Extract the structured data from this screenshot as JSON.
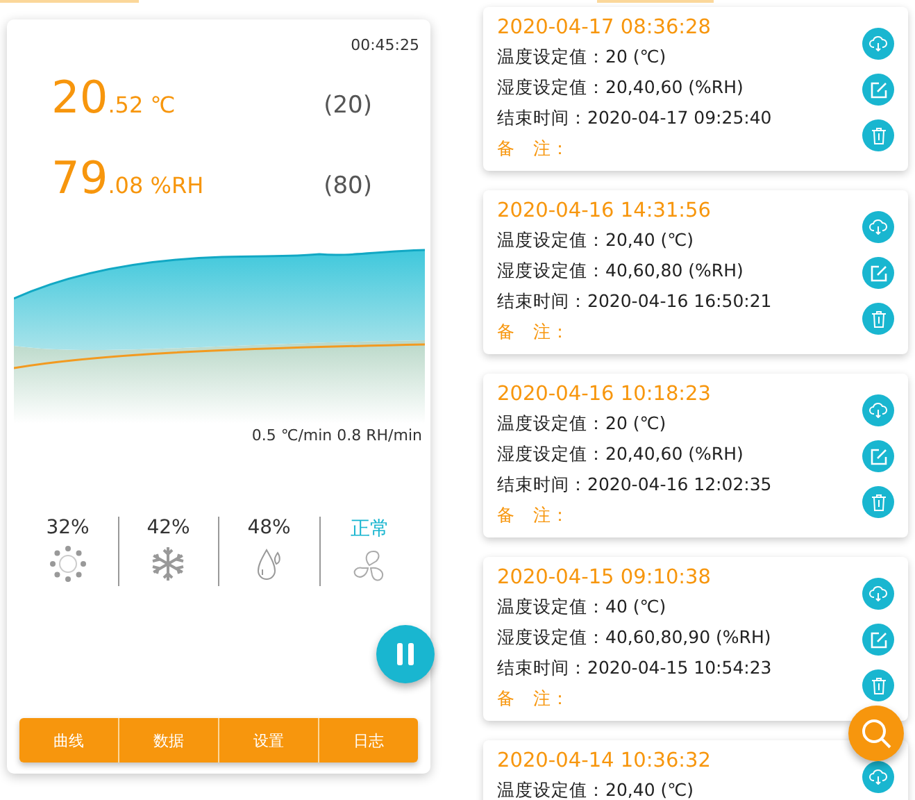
{
  "monitor": {
    "elapsed": "00:45:25",
    "readings": [
      {
        "integer": "20",
        "fraction": ".52",
        "unit": "℃",
        "setpoint": "(20)"
      },
      {
        "integer": "79",
        "fraction": ".08",
        "unit": "%RH",
        "setpoint": "(80)"
      }
    ],
    "rates": "0.5 ℃/min  0.8 RH/min",
    "outputs": [
      {
        "kind": "heat",
        "value": "32%"
      },
      {
        "kind": "cool",
        "value": "42%"
      },
      {
        "kind": "humidify",
        "value": "48%"
      },
      {
        "kind": "fan",
        "value": "正常"
      }
    ],
    "nav": [
      "曲线",
      "数据",
      "设置",
      "日志"
    ]
  },
  "records": [
    {
      "start": "2020-04-17 08:36:28",
      "lines": [
        "温度设定值：20 (℃)",
        "湿度设定值：20,40,60 (%RH)",
        "结束时间：2020-04-17 09:25:40"
      ],
      "note": "备　注：",
      "actions": [
        {
          "kind": "download"
        },
        {
          "kind": "edit"
        },
        {
          "kind": "delete"
        }
      ]
    },
    {
      "start": "2020-04-16 14:31:56",
      "lines": [
        "温度设定值：20,40 (℃)",
        "湿度设定值：40,60,80 (%RH)",
        "结束时间：2020-04-16 16:50:21"
      ],
      "note": "备　注：",
      "actions": [
        {
          "kind": "download"
        },
        {
          "kind": "edit"
        },
        {
          "kind": "delete"
        }
      ]
    },
    {
      "start": "2020-04-16 10:18:23",
      "lines": [
        "温度设定值：20 (℃)",
        "湿度设定值：20,40,60 (%RH)",
        "结束时间：2020-04-16 12:02:35"
      ],
      "note": "备　注：",
      "actions": [
        {
          "kind": "download"
        },
        {
          "kind": "edit"
        },
        {
          "kind": "delete"
        }
      ]
    },
    {
      "start": "2020-04-15 09:10:38",
      "lines": [
        "温度设定值：40 (℃)",
        "湿度设定值：40,60,80,90 (%RH)",
        "结束时间：2020-04-15 10:54:23"
      ],
      "note": "备　注：",
      "actions": [
        {
          "kind": "download"
        },
        {
          "kind": "edit"
        },
        {
          "kind": "delete"
        }
      ]
    },
    {
      "start": "2020-04-14 10:36:32",
      "lines": [
        "温度设定值：20,40 (℃)"
      ],
      "actions": [
        {
          "kind": "download"
        }
      ]
    }
  ]
}
